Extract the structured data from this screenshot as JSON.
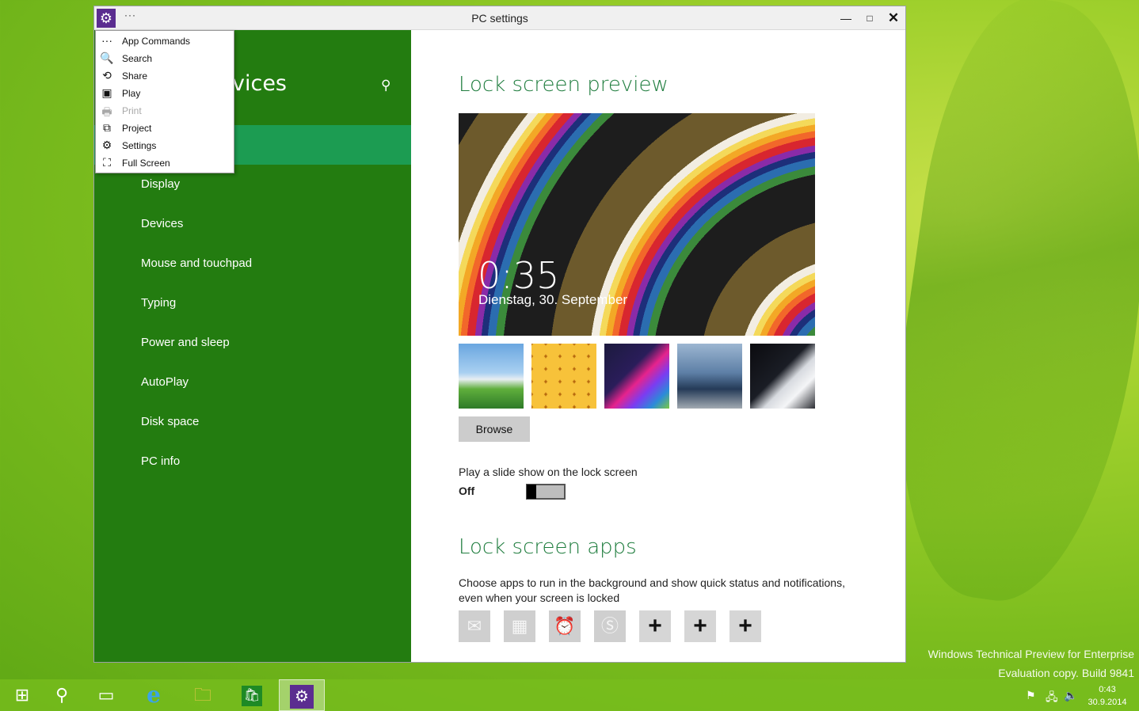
{
  "window": {
    "title": "PC settings",
    "more_label": "···",
    "min_label": "—",
    "max_label": "□",
    "close_label": "✕"
  },
  "left_pane": {
    "header_partial": "vices",
    "search_icon": "🔍",
    "nav_items": [
      "Display",
      "Devices",
      "Mouse and touchpad",
      "Typing",
      "Power and sleep",
      "AutoPlay",
      "Disk space",
      "PC info"
    ]
  },
  "app_commands_menu": {
    "items": [
      {
        "icon": "ellipsis-icon",
        "glyph": "···",
        "label": "App Commands",
        "enabled": true
      },
      {
        "icon": "search-icon",
        "glyph": "🔍",
        "label": "Search",
        "enabled": true
      },
      {
        "icon": "share-icon",
        "glyph": "⟲",
        "label": "Share",
        "enabled": true
      },
      {
        "icon": "play-icon",
        "glyph": "▣",
        "label": "Play",
        "enabled": true
      },
      {
        "icon": "print-icon",
        "glyph": "🖶",
        "label": "Print",
        "enabled": false
      },
      {
        "icon": "project-icon",
        "glyph": "⧉",
        "label": "Project",
        "enabled": true
      },
      {
        "icon": "gear-icon",
        "glyph": "⚙",
        "label": "Settings",
        "enabled": true
      },
      {
        "icon": "fullscreen-icon",
        "glyph": "⛶",
        "label": "Full Screen",
        "enabled": true
      }
    ]
  },
  "content": {
    "preview_title": "Lock screen preview",
    "preview_time": "0:35",
    "preview_date": "Dienstag, 30. September",
    "browse_label": "Browse",
    "slideshow_label": "Play a slide show on the lock screen",
    "slideshow_state": "Off",
    "apps_title": "Lock screen apps",
    "apps_desc_line1": "Choose apps to run in the background and show quick status and notifications,",
    "apps_desc_line2": "even when your screen is locked",
    "app_slots": [
      "mail-icon",
      "calendar-icon",
      "alarm-icon",
      "skype-icon",
      "add-icon",
      "add-icon",
      "add-icon"
    ]
  },
  "desktop": {
    "watermark_line1": "Windows Technical Preview for Enterprise",
    "watermark_line2": "Evaluation copy. Build 9841"
  },
  "taskbar": {
    "clock_time": "0:43",
    "clock_date": "30.9.2014"
  },
  "colors": {
    "accent_green": "#237c10",
    "selected_green": "#1c9c52",
    "title_green": "#1f7d3e",
    "settings_purple": "#5b2d90"
  }
}
